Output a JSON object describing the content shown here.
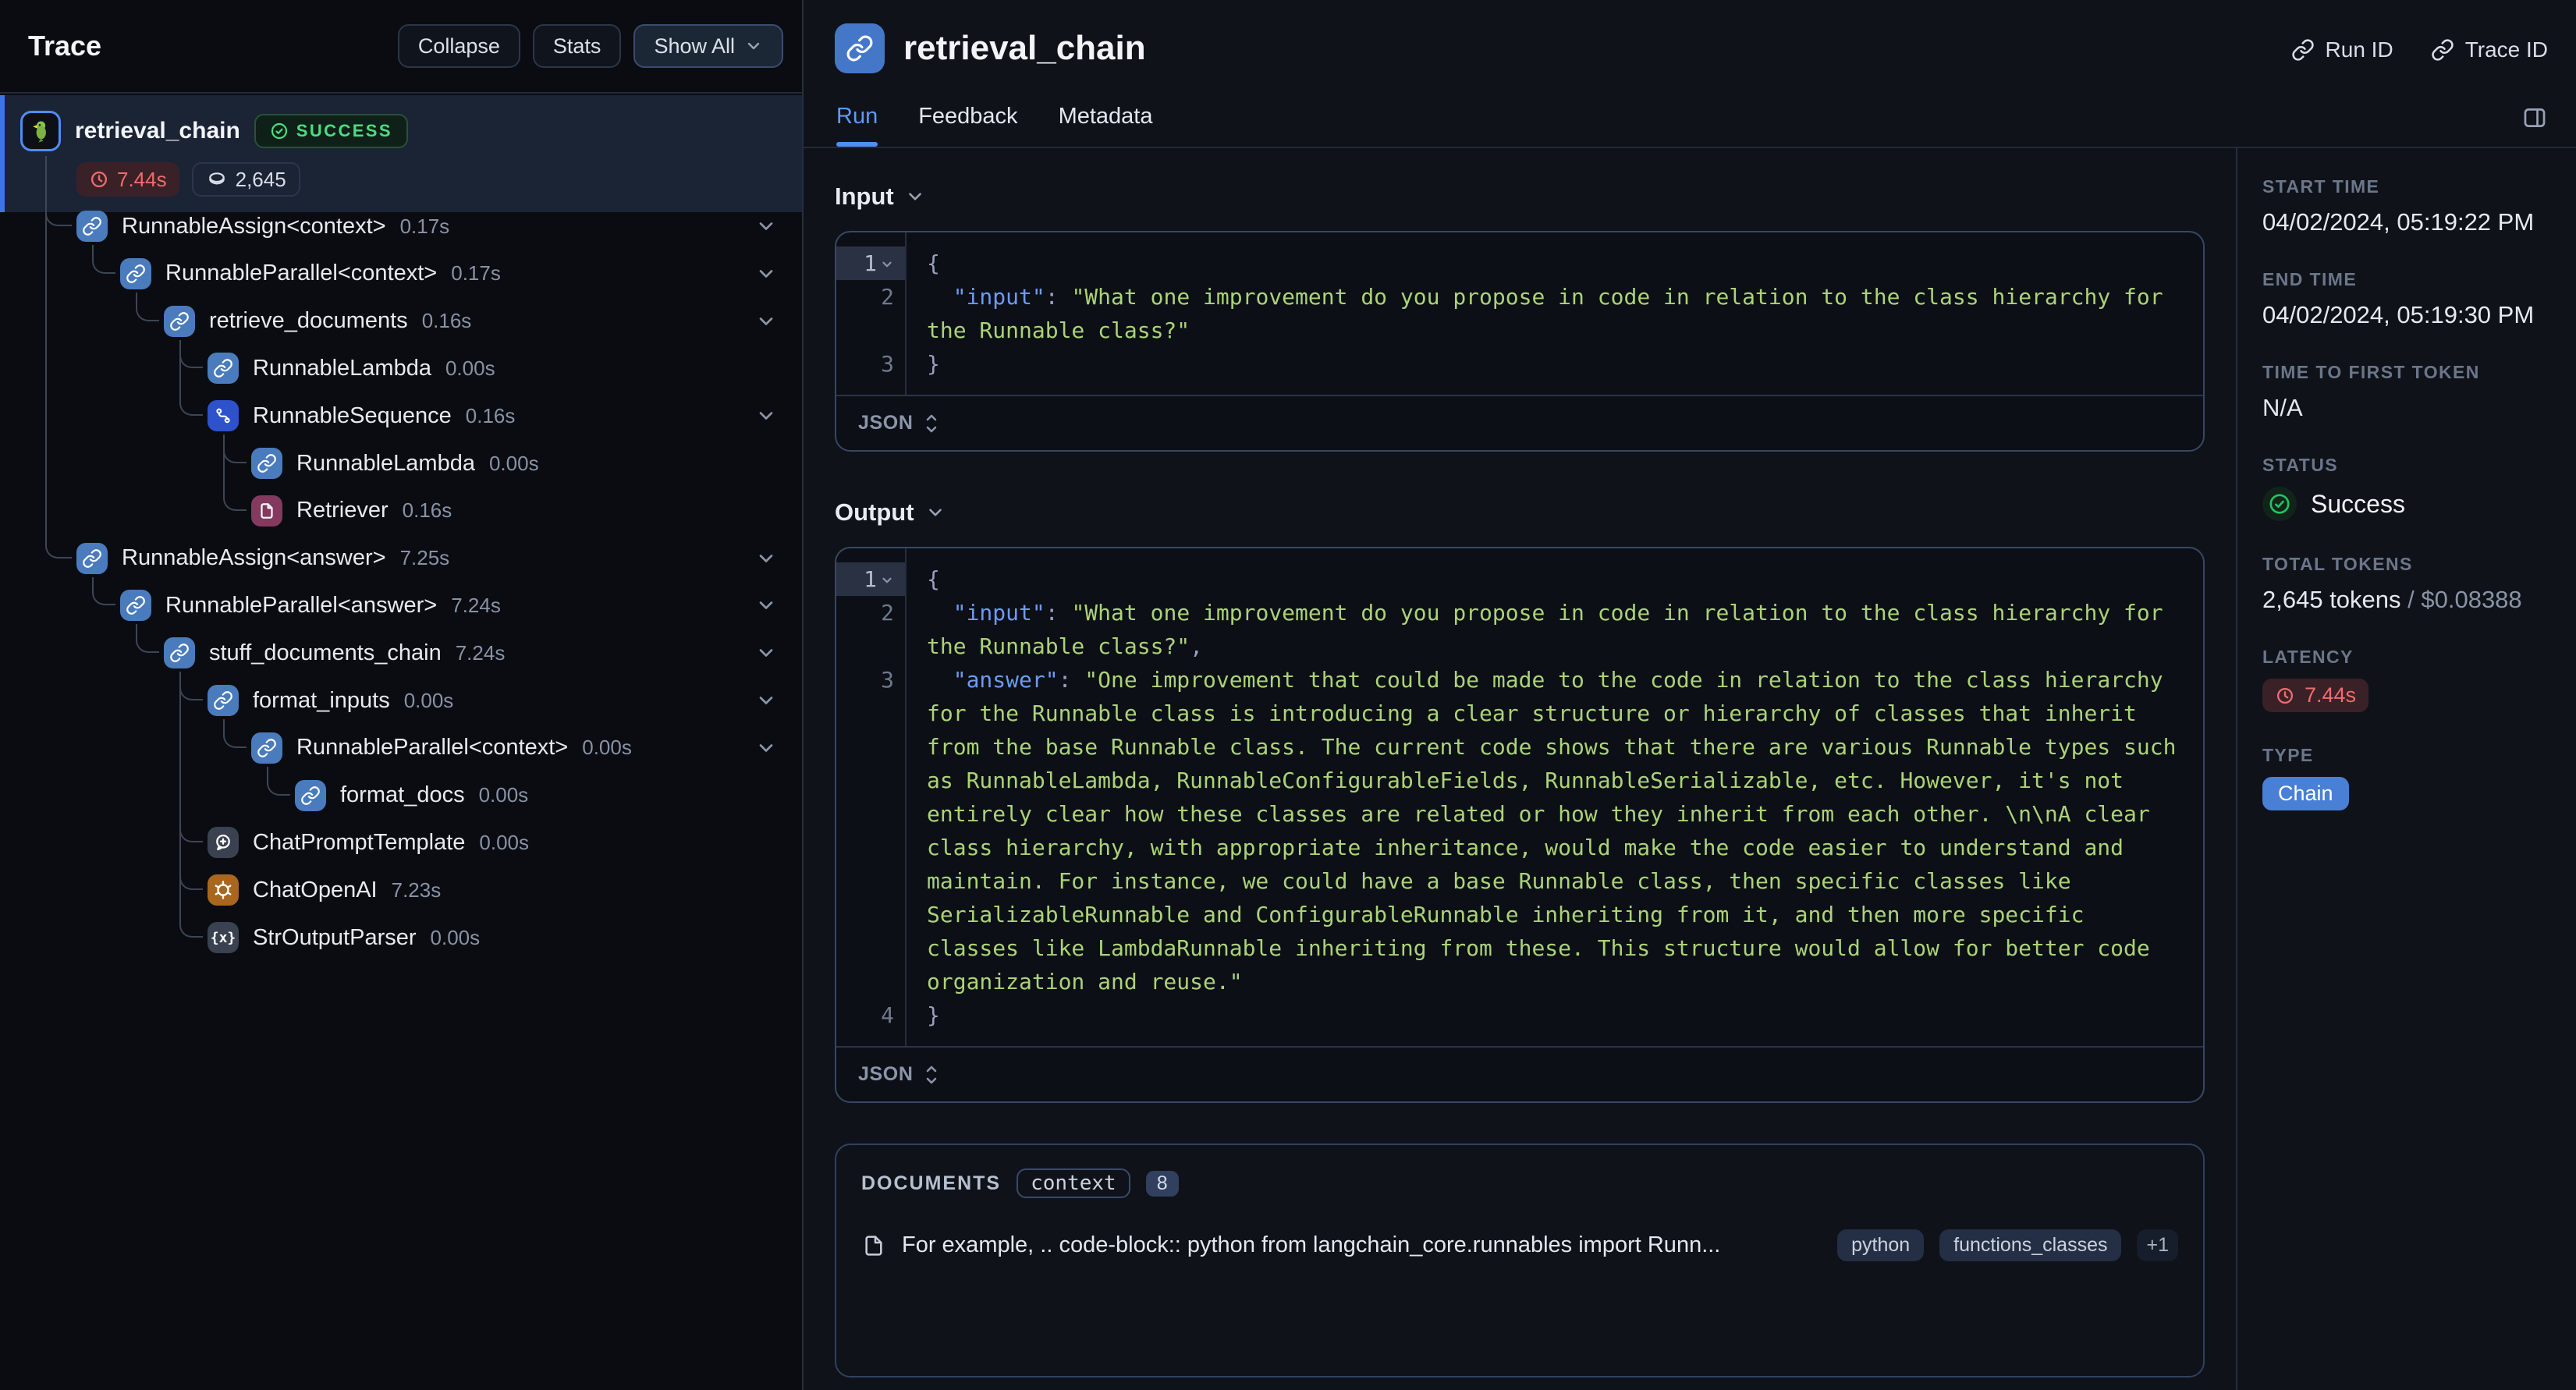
{
  "colors": {
    "accent_blue": "#4577c9",
    "tab_active": "#5c9bf5",
    "success_green": "#4ade80",
    "latency_red": "#ef6d6d",
    "chain_badge_blue": "#4a7fd6",
    "code_key_blue": "#6d9bf0",
    "code_string_green": "#abd377",
    "retriever_icon_bg": "#84395f",
    "openai_icon_bg": "#a8661f",
    "sequence_icon_bg": "#2d52cc",
    "selected_row_bg": "#1b2435"
  },
  "trace_panel": {
    "title": "Trace",
    "buttons": {
      "collapse": "Collapse",
      "stats": "Stats",
      "show_all": "Show All"
    },
    "root": {
      "name": "retrieval_chain",
      "status": "SUCCESS",
      "latency": "7.44s",
      "tokens": "2,645",
      "icon": "parrot"
    },
    "nodes": [
      {
        "label": "RunnableAssign<context>",
        "duration": "0.17s",
        "icon": "link",
        "level": 1,
        "chevron": true,
        "parent": -1
      },
      {
        "label": "RunnableParallel<context>",
        "duration": "0.17s",
        "icon": "link",
        "level": 2,
        "chevron": true,
        "parent": 0
      },
      {
        "label": "retrieve_documents",
        "duration": "0.16s",
        "icon": "link",
        "level": 3,
        "chevron": true,
        "parent": 1
      },
      {
        "label": "RunnableLambda",
        "duration": "0.00s",
        "icon": "link",
        "level": 4,
        "chevron": false,
        "parent": 2
      },
      {
        "label": "RunnableSequence",
        "duration": "0.16s",
        "icon": "seq",
        "level": 4,
        "chevron": true,
        "parent": 2
      },
      {
        "label": "RunnableLambda",
        "duration": "0.00s",
        "icon": "link",
        "level": 5,
        "chevron": false,
        "parent": 4
      },
      {
        "label": "Retriever",
        "duration": "0.16s",
        "icon": "file",
        "level": 5,
        "chevron": false,
        "parent": 4
      },
      {
        "label": "RunnableAssign<answer>",
        "duration": "7.25s",
        "icon": "link",
        "level": 1,
        "chevron": true,
        "parent": -1
      },
      {
        "label": "RunnableParallel<answer>",
        "duration": "7.24s",
        "icon": "link",
        "level": 2,
        "chevron": true,
        "parent": 7
      },
      {
        "label": "stuff_documents_chain",
        "duration": "7.24s",
        "icon": "link",
        "level": 3,
        "chevron": true,
        "parent": 8
      },
      {
        "label": "format_inputs",
        "duration": "0.00s",
        "icon": "link",
        "level": 4,
        "chevron": true,
        "parent": 9
      },
      {
        "label": "RunnableParallel<context>",
        "duration": "0.00s",
        "icon": "link",
        "level": 5,
        "chevron": true,
        "parent": 10
      },
      {
        "label": "format_docs",
        "duration": "0.00s",
        "icon": "link",
        "level": 6,
        "chevron": false,
        "parent": 11
      },
      {
        "label": "ChatPromptTemplate",
        "duration": "0.00s",
        "icon": "prompt",
        "level": 4,
        "chevron": false,
        "parent": 9
      },
      {
        "label": "ChatOpenAI",
        "duration": "7.23s",
        "icon": "openai",
        "level": 4,
        "chevron": false,
        "parent": 9
      },
      {
        "label": "StrOutputParser",
        "duration": "0.00s",
        "icon": "parser",
        "level": 4,
        "chevron": false,
        "parent": 9
      }
    ]
  },
  "header": {
    "title": "retrieval_chain",
    "run_id_label": "Run ID",
    "trace_id_label": "Trace ID",
    "tabs": [
      {
        "label": "Run",
        "active": true
      },
      {
        "label": "Feedback",
        "active": false
      },
      {
        "label": "Metadata",
        "active": false
      }
    ]
  },
  "run_view": {
    "input": {
      "heading": "Input",
      "format_label": "JSON",
      "lines": [
        {
          "num": "1",
          "active": true,
          "fold": true,
          "segments": [
            {
              "c": "sb",
              "t": "{"
            }
          ]
        },
        {
          "num": "2",
          "segments": [
            {
              "c": "sp",
              "t": "  "
            },
            {
              "c": "sk",
              "t": "\"input\""
            },
            {
              "c": "sp",
              "t": ": "
            },
            {
              "c": "ss",
              "t": "\"What one improvement do you propose in code in relation to the class hierarchy for the Runnable class?\""
            }
          ]
        },
        {
          "num": "3",
          "segments": [
            {
              "c": "sb",
              "t": "}"
            }
          ]
        }
      ]
    },
    "output": {
      "heading": "Output",
      "format_label": "JSON",
      "lines": [
        {
          "num": "1",
          "active": true,
          "fold": true,
          "segments": [
            {
              "c": "sb",
              "t": "{"
            }
          ]
        },
        {
          "num": "2",
          "segments": [
            {
              "c": "sp",
              "t": "  "
            },
            {
              "c": "sk",
              "t": "\"input\""
            },
            {
              "c": "sp",
              "t": ": "
            },
            {
              "c": "ss",
              "t": "\"What one improvement do you propose in code in relation to the class hierarchy for the Runnable class?\""
            },
            {
              "c": "sp",
              "t": ","
            }
          ]
        },
        {
          "num": "3",
          "segments": [
            {
              "c": "sp",
              "t": "  "
            },
            {
              "c": "sk",
              "t": "\"answer\""
            },
            {
              "c": "sp",
              "t": ": "
            },
            {
              "c": "ss",
              "t": "\"One improvement that could be made to the code in relation to the class hierarchy for the Runnable class is introducing a clear structure or hierarchy of classes that inherit from the base Runnable class. The current code shows that there are various Runnable types such as RunnableLambda, RunnableConfigurableFields, RunnableSerializable, etc. However, it's not entirely clear how these classes are related or how they inherit from each other. \\n\\nA clear class hierarchy, with appropriate inheritance, would make the code easier to understand and maintain. For instance, we could have a base Runnable class, then specific classes like SerializableRunnable and ConfigurableRunnable inheriting from it, and then more specific classes like LambdaRunnable inheriting from these. This structure would allow for better code organization and reuse.\""
            }
          ]
        },
        {
          "num": "4",
          "segments": [
            {
              "c": "sb",
              "t": "}"
            }
          ]
        }
      ]
    },
    "documents": {
      "heading": "DOCUMENTS",
      "key_badge": "context",
      "count": "8",
      "items": [
        {
          "text": "For example, .. code-block:: python from langchain_core.runnables import Runn...",
          "tags": [
            "python",
            "functions_classes"
          ],
          "more": "+1"
        }
      ]
    }
  },
  "details_panel": {
    "sections": [
      {
        "label": "START TIME",
        "type": "text",
        "value": "04/02/2024, 05:19:22 PM"
      },
      {
        "label": "END TIME",
        "type": "text",
        "value": "04/02/2024, 05:19:30 PM"
      },
      {
        "label": "TIME TO FIRST TOKEN",
        "type": "text",
        "value": "N/A"
      },
      {
        "label": "STATUS",
        "type": "status",
        "value": "Success"
      },
      {
        "label": "TOTAL TOKENS",
        "type": "tokens",
        "value": "2,645 tokens",
        "value_secondary": " / $0.08388"
      },
      {
        "label": "LATENCY",
        "type": "latency",
        "value": "7.44s"
      },
      {
        "label": "TYPE",
        "type": "chain-badge",
        "value": "Chain"
      }
    ]
  }
}
